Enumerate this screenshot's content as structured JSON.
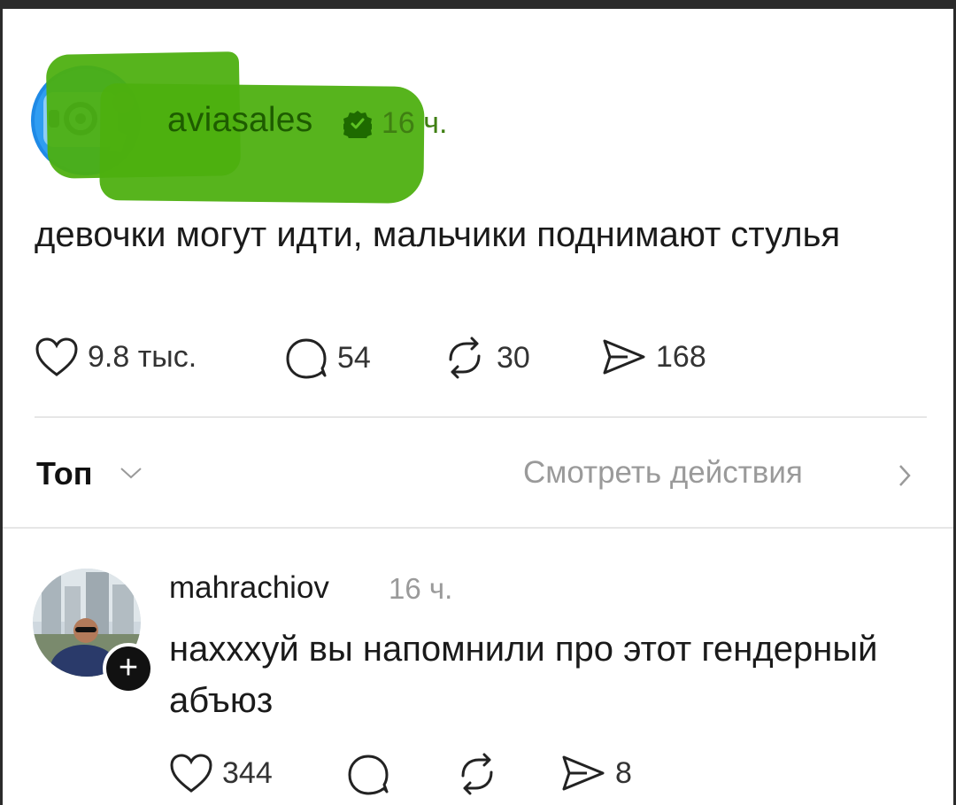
{
  "post": {
    "author": "aviasales",
    "time": "16 ч.",
    "text": "девочки могут идти, мальчики поднимают стулья",
    "likes": "9.8 тыс.",
    "replies": "54",
    "reposts": "30",
    "shares": "168"
  },
  "sort": {
    "label": "Топ",
    "view_activity": "Смотреть действия"
  },
  "reply": {
    "author": "mahrachiov",
    "time": "16 ч.",
    "text": "нахххуй вы напомнили про этот гендерный абъюз",
    "likes": "344",
    "shares": "8"
  },
  "colors": {
    "highlight": "#4caf0f",
    "text": "#1a1a1a",
    "muted": "#9a9a9a"
  },
  "icons": [
    "heart-icon",
    "comment-icon",
    "repost-icon",
    "share-icon",
    "verified-icon",
    "chevron-down-icon",
    "chevron-right-icon",
    "plus-icon"
  ]
}
